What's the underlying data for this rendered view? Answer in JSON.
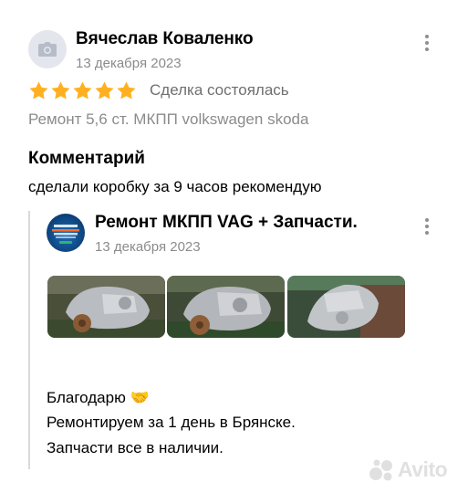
{
  "review": {
    "author_name": "Вячеслав Коваленко",
    "date": "13 декабря 2023",
    "rating": 5,
    "rating_max": 5,
    "deal_status": "Сделка состоялась",
    "item_title": "Ремонт 5,6 ст. МКПП volkswagen skoda",
    "comment_heading": "Комментарий",
    "comment_text": "сделали коробку за 9 часов рекомендую"
  },
  "reply": {
    "seller_name": "Ремонт МКПП VAG + Запчасти.",
    "date": "13 декабря 2023",
    "lines": [
      "Благодарю 🤝",
      "Ремонтируем за 1 день в Брянске.",
      "Запчасти все в наличии."
    ]
  },
  "watermark": {
    "text": "Avito"
  },
  "colors": {
    "star": "#ffb021",
    "secondary_text": "#8b8b8b"
  },
  "icons": {
    "avatar_placeholder": "camera-icon",
    "menu": "more-vertical-icon",
    "star": "star-icon"
  }
}
